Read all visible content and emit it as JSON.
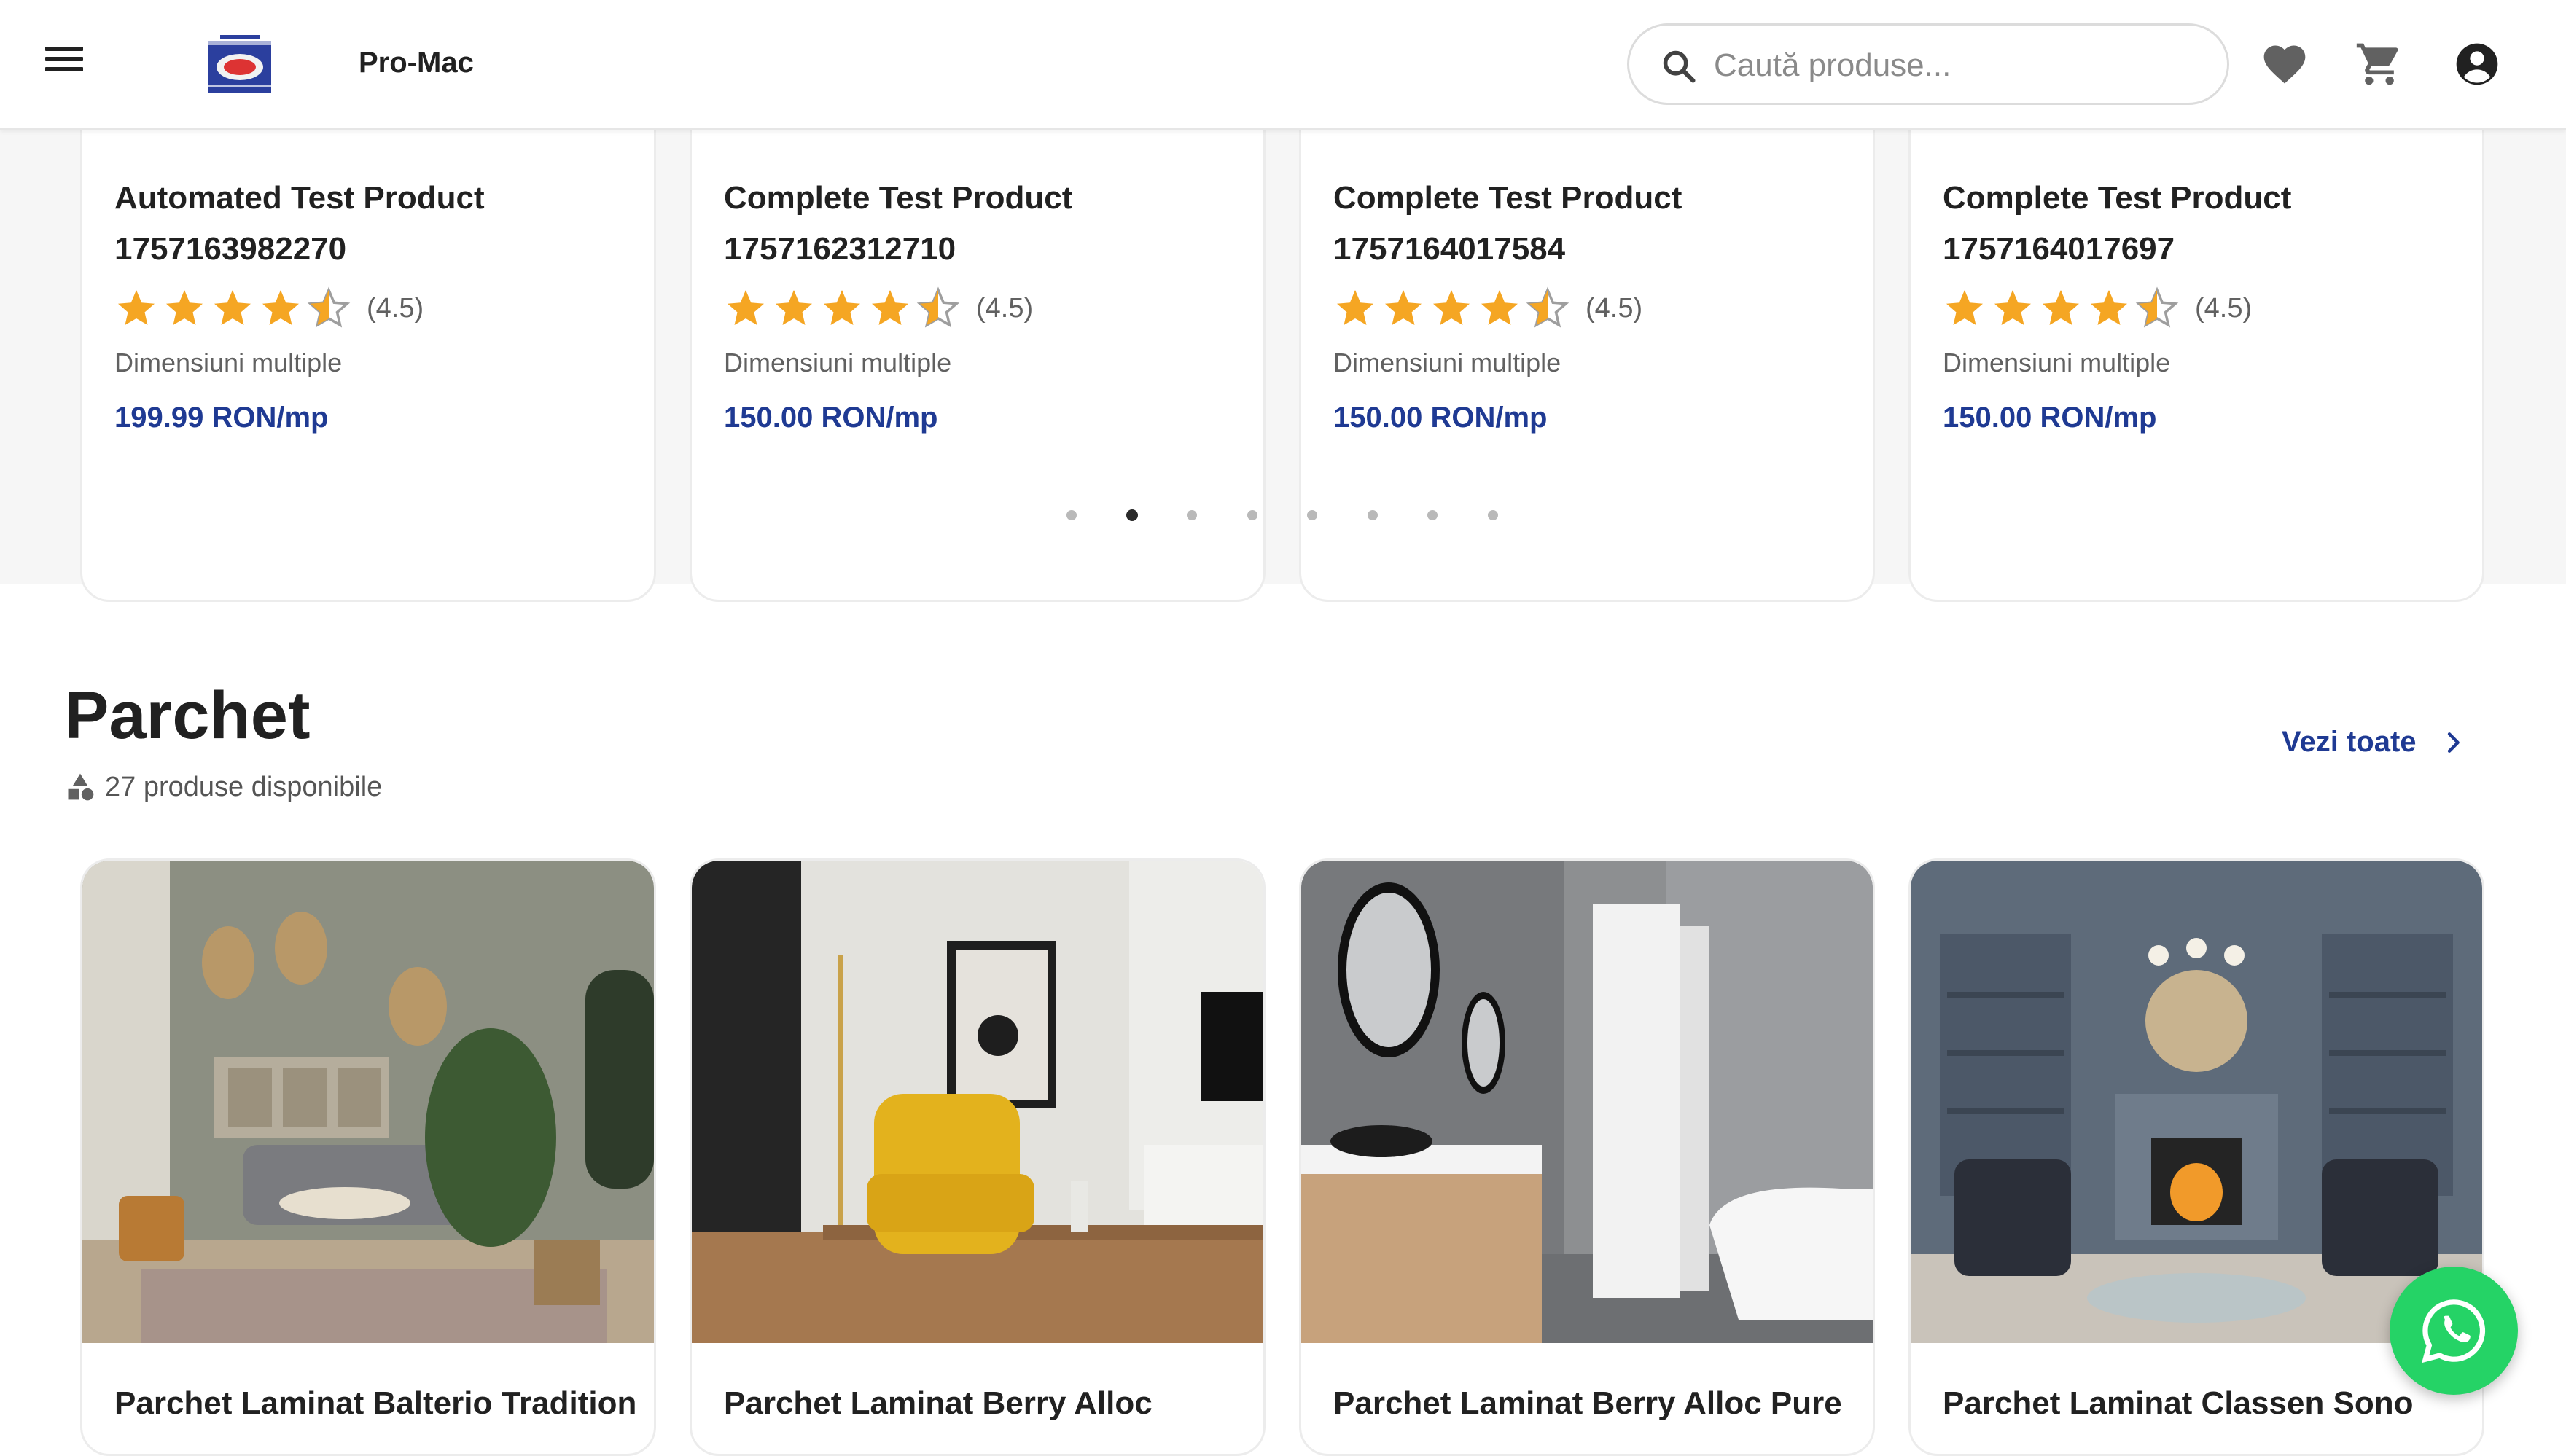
{
  "header": {
    "brand": "Pro-Mac",
    "search_placeholder": "Caută produse...",
    "icons": [
      "menu-icon",
      "logo",
      "search-icon",
      "heart-icon",
      "cart-icon",
      "account-icon"
    ]
  },
  "carousel": {
    "products": [
      {
        "name_line1": "Automated Test Product",
        "name_line2": "1757163982270",
        "rating": 4.5,
        "rating_text": "(4.5)",
        "dimensions": "Dimensiuni multiple",
        "price": "199.99 RON/mp"
      },
      {
        "name_line1": "Complete Test Product",
        "name_line2": "1757162312710",
        "rating": 4.5,
        "rating_text": "(4.5)",
        "dimensions": "Dimensiuni multiple",
        "price": "150.00 RON/mp"
      },
      {
        "name_line1": "Complete Test Product",
        "name_line2": "1757164017584",
        "rating": 4.5,
        "rating_text": "(4.5)",
        "dimensions": "Dimensiuni multiple",
        "price": "150.00 RON/mp"
      },
      {
        "name_line1": "Complete Test Product",
        "name_line2": "1757164017697",
        "rating": 4.5,
        "rating_text": "(4.5)",
        "dimensions": "Dimensiuni multiple",
        "price": "150.00 RON/mp"
      }
    ],
    "page_count": 8,
    "active_page": 2
  },
  "category": {
    "title": "Parchet",
    "count_text": "27 produse disponibile",
    "see_all": "Vezi toate",
    "products": [
      {
        "name": "Parchet Laminat Balterio Tradition"
      },
      {
        "name": "Parchet Laminat Berry Alloc"
      },
      {
        "name": "Parchet Laminat Berry Alloc Pure"
      },
      {
        "name": "Parchet Laminat Classen Sono"
      }
    ]
  },
  "colors": {
    "accent": "#1f3a93",
    "star": "#f5a623",
    "whatsapp": "#25d366"
  }
}
